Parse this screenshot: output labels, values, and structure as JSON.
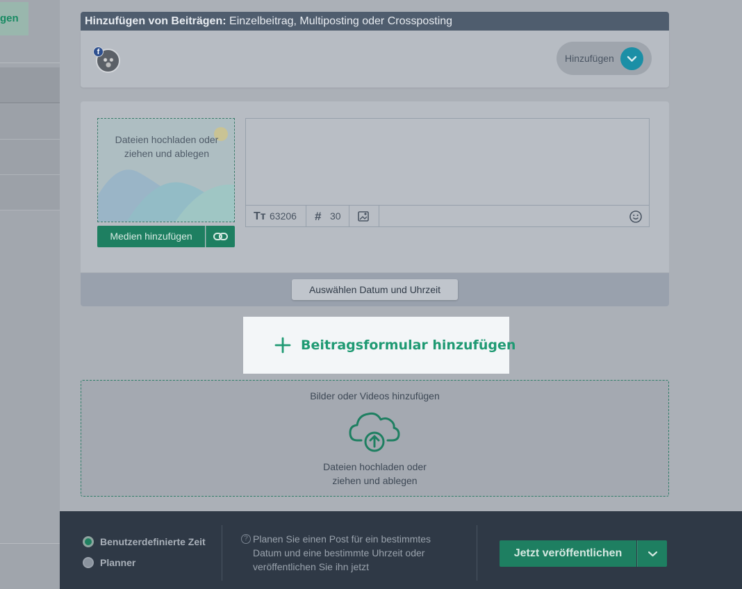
{
  "sidebar": {
    "partial_button_label": "gen"
  },
  "header": {
    "title_bold": "Hinzufügen von Beiträgen:",
    "title_rest": "Einzelbeitrag, Multiposting oder Crossposting"
  },
  "accounts": {
    "network_badge": "f",
    "add_label": "Hinzufügen"
  },
  "composer": {
    "dropzone_text_line1": "Dateien hochladen oder",
    "dropzone_text_line2": "ziehen und ablegen",
    "add_media_label": "Medien hinzufügen",
    "char_count": "63206",
    "hashtag_count": "30",
    "schedule_button_label": "Auswählen Datum und Uhrzeit"
  },
  "add_form": {
    "label": "Beitragsformular hinzufügen"
  },
  "media_zone": {
    "title": "Bilder oder Videos hinzufügen",
    "text_line1": "Dateien hochladen oder",
    "text_line2": "ziehen und ablegen"
  },
  "footer": {
    "options": [
      {
        "label": "Benutzerdefinierte Zeit",
        "selected": true
      },
      {
        "label": "Planner",
        "selected": false
      }
    ],
    "help_icon": "?",
    "help_text_line1": "Planen Sie einen Post für ein bestimmtes",
    "help_text_line2": "Datum und eine bestimmte Uhrzeit oder",
    "help_text_line3": "veröffentlichen Sie ihn jetzt",
    "publish_label": "Jetzt veröffentlichen"
  },
  "colors": {
    "accent_green": "#1e7f61",
    "highlight_green_text": "#1f9a73",
    "dropdown_teal": "#1b8fa6",
    "header_bg": "#4f5d6e",
    "footer_bg": "#2f3946"
  }
}
